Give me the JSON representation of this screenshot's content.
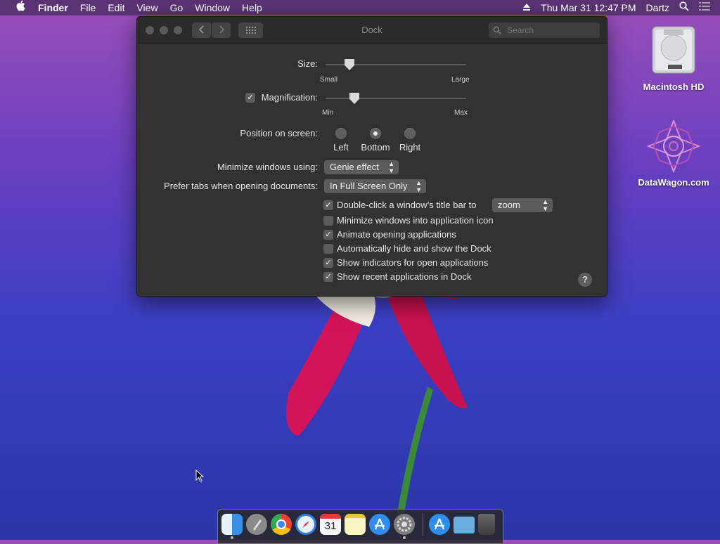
{
  "menubar": {
    "apple_icon": "apple-logo-icon",
    "app_name": "Finder",
    "menus": [
      "File",
      "Edit",
      "View",
      "Go",
      "Window",
      "Help"
    ],
    "clock": "Thu Mar 31  12:47 PM",
    "user": "Dartz",
    "eject_icon": "eject-icon",
    "search_icon": "spotlight-search-icon",
    "notification_icon": "notification-center-icon"
  },
  "desktop": {
    "icons": [
      {
        "label": "Macintosh HD",
        "icon": "hard-drive-icon"
      },
      {
        "label": "DataWagon.com",
        "icon": "mandala-graphic-icon"
      }
    ]
  },
  "window": {
    "title": "Dock",
    "search_placeholder": "Search",
    "size": {
      "label": "Size:",
      "min_label": "Small",
      "max_label": "Large",
      "value_fraction": 0.2
    },
    "magnification": {
      "label": "Magnification:",
      "checked": true,
      "min_label": "Min",
      "max_label": "Max",
      "value_fraction": 0.2
    },
    "position": {
      "label": "Position on screen:",
      "options": [
        "Left",
        "Bottom",
        "Right"
      ],
      "selected": "Bottom"
    },
    "minimize_using": {
      "label": "Minimize windows using:",
      "value": "Genie effect"
    },
    "prefer_tabs": {
      "label": "Prefer tabs when opening documents:",
      "value": "In Full Screen Only"
    },
    "double_click": {
      "label": "Double-click a window’s title bar to",
      "checked": true,
      "value": "zoom"
    },
    "options": [
      {
        "label": "Minimize windows into application icon",
        "checked": false
      },
      {
        "label": "Animate opening applications",
        "checked": true
      },
      {
        "label": "Automatically hide and show the Dock",
        "checked": false
      },
      {
        "label": "Show indicators for open applications",
        "checked": true
      },
      {
        "label": "Show recent applications in Dock",
        "checked": true
      }
    ],
    "help_label": "?"
  },
  "dock": {
    "apps": [
      {
        "name": "Finder",
        "color": "#3a8ee6",
        "running": true
      },
      {
        "name": "Launchpad",
        "color": "#8a8a8a",
        "running": false
      },
      {
        "name": "Chrome",
        "color": "#e8e8e8",
        "running": false
      },
      {
        "name": "Safari",
        "color": "#2a7fe0",
        "running": false
      },
      {
        "name": "Calendar",
        "color": "#f4f4f4",
        "running": false,
        "text": "31"
      },
      {
        "name": "Notes",
        "color": "#f6e27a",
        "running": false
      },
      {
        "name": "App Store",
        "color": "#2f8df0",
        "running": false
      },
      {
        "name": "System Preferences",
        "color": "#7d7d7d",
        "running": true
      },
      {
        "name": "App Store recent",
        "color": "#2f8df0",
        "running": false
      },
      {
        "name": "Downloads",
        "color": "#6aaee0",
        "running": false
      },
      {
        "name": "Trash",
        "color": "#555555",
        "running": false
      }
    ]
  }
}
